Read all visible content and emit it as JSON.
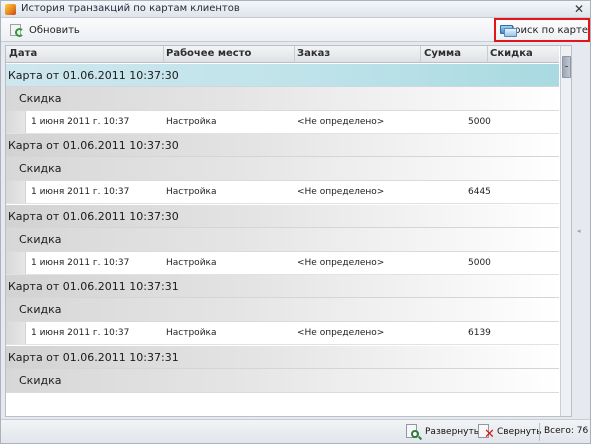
{
  "window": {
    "title": "История транзакций по картам клиентов"
  },
  "toolbar": {
    "refresh_label": "Обновить",
    "search_card_label": "Поиск по карте"
  },
  "grid": {
    "columns": [
      "Дата",
      "Рабочее место",
      "Заказ",
      "Сумма",
      "Скидка"
    ],
    "groups": [
      {
        "card": "Карта от 01.06.2011 10:37:30",
        "sub": "Скидка",
        "row": {
          "date": "1 июня 2011 г. 10:37",
          "workplace": "Настройка",
          "order": "<Не определено>",
          "sum": "5000"
        }
      },
      {
        "card": "Карта от 01.06.2011 10:37:30",
        "sub": "Скидка",
        "row": {
          "date": "1 июня 2011 г. 10:37",
          "workplace": "Настройка",
          "order": "<Не определено>",
          "sum": "6445"
        }
      },
      {
        "card": "Карта от 01.06.2011 10:37:30",
        "sub": "Скидка",
        "row": {
          "date": "1 июня 2011 г. 10:37",
          "workplace": "Настройка",
          "order": "<Не определено>",
          "sum": "5000"
        }
      },
      {
        "card": "Карта от 01.06.2011 10:37:31",
        "sub": "Скидка",
        "row": {
          "date": "1 июня 2011 г. 10:37",
          "workplace": "Настройка",
          "order": "<Не определено>",
          "sum": "6139"
        }
      },
      {
        "card": "Карта от 01.06.2011 10:37:31",
        "sub": "Скидка"
      }
    ]
  },
  "status": {
    "expand_label": "Развернуть",
    "collapse_label": "Свернуть",
    "total_label": "Всего: 76"
  }
}
